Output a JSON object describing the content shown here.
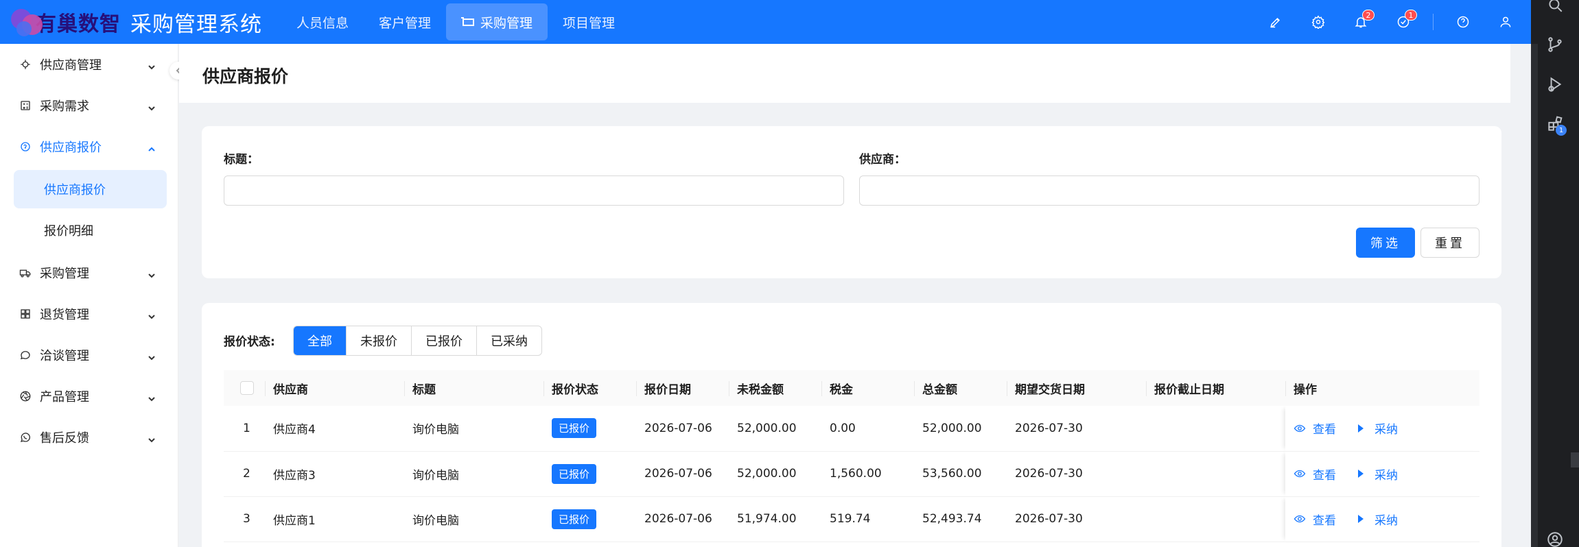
{
  "header": {
    "brand": "有巢数智",
    "title": "采购管理系统",
    "nav": [
      {
        "label": "人员信息",
        "active": false
      },
      {
        "label": "客户管理",
        "active": false
      },
      {
        "label": "采购管理",
        "active": true
      },
      {
        "label": "项目管理",
        "active": false
      }
    ],
    "icons": [
      {
        "name": "brush-icon"
      },
      {
        "name": "settings-icon"
      },
      {
        "name": "bell-icon",
        "badge": "2"
      },
      {
        "name": "task-check-icon",
        "badge": "1"
      },
      {
        "name": "help-icon"
      },
      {
        "name": "user-icon"
      }
    ],
    "accent": "#1677ff"
  },
  "sidebar": {
    "items": [
      {
        "label": "供应商管理",
        "icon": "target-icon",
        "expanded": false
      },
      {
        "label": "采购需求",
        "icon": "calculator-icon",
        "expanded": false
      },
      {
        "label": "供应商报价",
        "icon": "quote-icon",
        "expanded": true,
        "children": [
          {
            "label": "供应商报价",
            "active": true
          },
          {
            "label": "报价明细",
            "active": false
          }
        ]
      },
      {
        "label": "采购管理",
        "icon": "truck-icon",
        "expanded": false
      },
      {
        "label": "退货管理",
        "icon": "grid-icon",
        "expanded": false
      },
      {
        "label": "洽谈管理",
        "icon": "chat-icon",
        "expanded": false
      },
      {
        "label": "产品管理",
        "icon": "aperture-icon",
        "expanded": false
      },
      {
        "label": "售后反馈",
        "icon": "whatsapp-icon",
        "expanded": false
      }
    ]
  },
  "page": {
    "title": "供应商报价"
  },
  "filters": {
    "title_label": "标题：",
    "title_value": "",
    "supplier_label": "供应商：",
    "supplier_value": "",
    "filter_btn": "筛选",
    "reset_btn": "重置"
  },
  "status_filter": {
    "label": "报价状态:",
    "options": [
      "全部",
      "未报价",
      "已报价",
      "已采纳"
    ],
    "selected": "全部"
  },
  "table": {
    "columns": [
      "供应商",
      "标题",
      "报价状态",
      "报价日期",
      "未税金额",
      "税金",
      "总金额",
      "期望交货日期",
      "报价截止日期",
      "操作"
    ],
    "rows": [
      {
        "index": "1",
        "supplier": "供应商4",
        "title": "询价电脑",
        "status": "已报价",
        "date": "2026-07-06",
        "pretax": "52,000.00",
        "tax": "0.00",
        "total": "52,000.00",
        "delivery": "2026-07-30",
        "deadline": ""
      },
      {
        "index": "2",
        "supplier": "供应商3",
        "title": "询价电脑",
        "status": "已报价",
        "date": "2026-07-06",
        "pretax": "52,000.00",
        "tax": "1,560.00",
        "total": "53,560.00",
        "delivery": "2026-07-30",
        "deadline": ""
      },
      {
        "index": "3",
        "supplier": "供应商1",
        "title": "询价电脑",
        "status": "已报价",
        "date": "2026-07-06",
        "pretax": "51,974.00",
        "tax": "519.74",
        "total": "52,493.74",
        "delivery": "2026-07-30",
        "deadline": ""
      }
    ],
    "actions": {
      "view": "查看",
      "adopt": "采纳"
    }
  },
  "rail": {
    "icons": [
      "search-icon",
      "source-control-icon",
      "run-debug-icon",
      "extensions-icon",
      "account-icon"
    ],
    "extensions_badge": "1"
  }
}
